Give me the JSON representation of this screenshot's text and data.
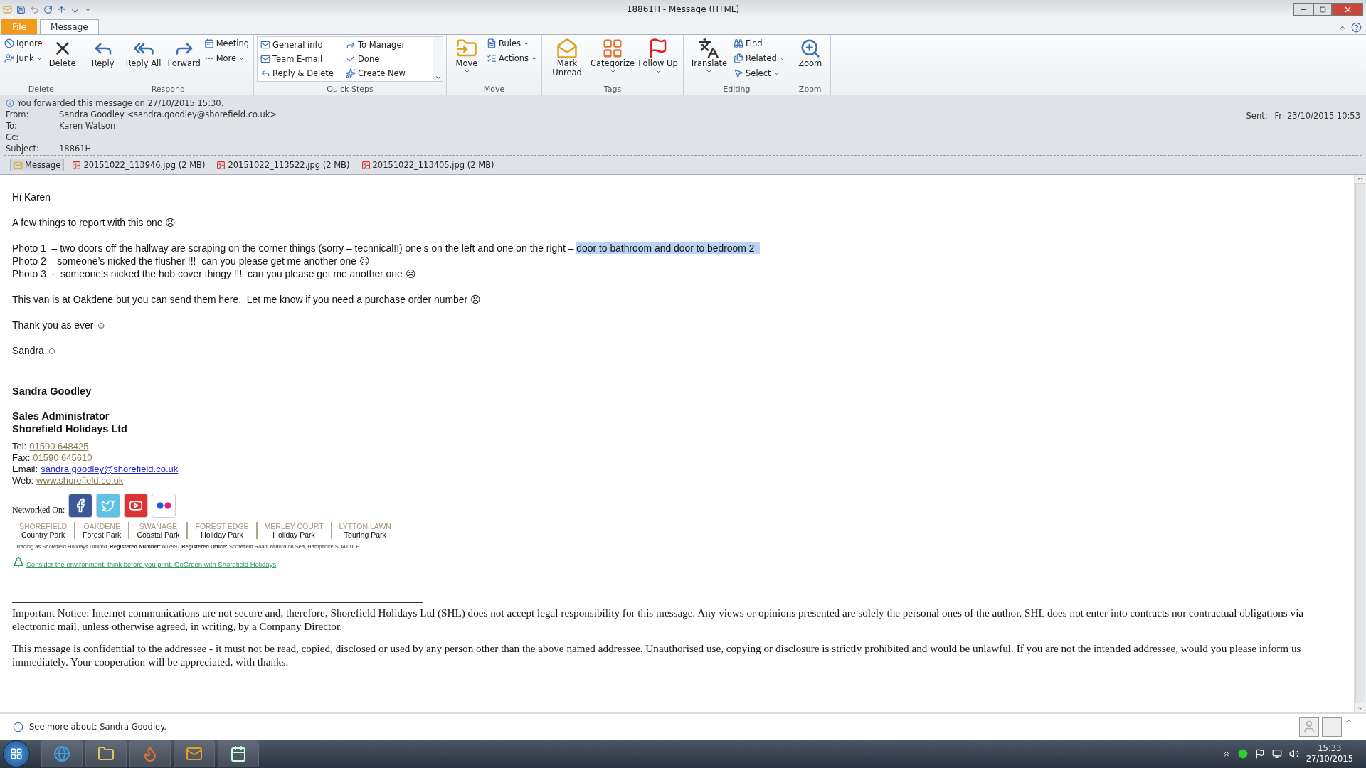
{
  "window": {
    "title": "18861H  -  Message (HTML)"
  },
  "tabs": [
    {
      "label": "File",
      "kind": "file",
      "selected": false
    },
    {
      "label": "Message",
      "kind": "tab",
      "selected": true
    }
  ],
  "ribbon": [
    {
      "label": "Delete",
      "items": [
        {
          "label": "Ignore",
          "kind": "small"
        },
        {
          "label": "Junk",
          "kind": "small",
          "dropdown": true
        },
        {
          "label": "Delete",
          "kind": "large"
        }
      ]
    },
    {
      "label": "Respond",
      "items": [
        {
          "label": "Reply",
          "kind": "large"
        },
        {
          "label": "Reply All",
          "kind": "large"
        },
        {
          "label": "Forward",
          "kind": "large"
        },
        {
          "label": "Meeting",
          "kind": "small"
        },
        {
          "label": "More",
          "kind": "small",
          "dropdown": true
        }
      ]
    },
    {
      "label": "Quick Steps",
      "items": [
        {
          "label": "General info",
          "kind": "quick"
        },
        {
          "label": "To Manager",
          "kind": "quick"
        },
        {
          "label": "Team E-mail",
          "kind": "quick"
        },
        {
          "label": "Done",
          "kind": "quick"
        },
        {
          "label": "Reply & Delete",
          "kind": "quick"
        },
        {
          "label": "Create New",
          "kind": "quick"
        }
      ]
    },
    {
      "label": "Move",
      "items": [
        {
          "label": "Move",
          "kind": "large",
          "dropdown": true
        },
        {
          "label": "Rules",
          "kind": "small",
          "dropdown": true
        },
        {
          "label": "Actions",
          "kind": "small",
          "dropdown": true
        }
      ]
    },
    {
      "label": "Tags",
      "items": [
        {
          "label": "Mark Unread",
          "kind": "large"
        },
        {
          "label": "Categorize",
          "kind": "large",
          "dropdown": true
        },
        {
          "label": "Follow Up",
          "kind": "large",
          "dropdown": true
        }
      ]
    },
    {
      "label": "Editing",
      "items": [
        {
          "label": "Translate",
          "kind": "large",
          "dropdown": true
        },
        {
          "label": "Find",
          "kind": "small"
        },
        {
          "label": "Related",
          "kind": "small",
          "dropdown": true
        },
        {
          "label": "Select",
          "kind": "small",
          "dropdown": true
        }
      ]
    },
    {
      "label": "Zoom",
      "items": [
        {
          "label": "Zoom",
          "kind": "large"
        }
      ]
    }
  ],
  "info_bar": "You forwarded this message on 27/10/2015 15:30.",
  "header": {
    "fields": [
      {
        "label": "From:",
        "value": "Sandra Goodley <sandra.goodley@shorefield.co.uk>"
      },
      {
        "label": "To:",
        "value": "Karen Watson"
      },
      {
        "label": "Cc:"
      },
      {
        "label": "Subject:",
        "value": "18861H"
      }
    ],
    "sent_label": "Sent:",
    "sent_value": "Fri 23/10/2015 10:53"
  },
  "attachments": [
    {
      "label": "Message",
      "kind": "message",
      "selected": true
    },
    {
      "label": "20151022_113946.jpg (2 MB)",
      "kind": "file",
      "selected": false
    },
    {
      "label": "20151022_113522.jpg (2 MB)",
      "kind": "file",
      "selected": false
    },
    {
      "label": "20151022_113405.jpg (2 MB)",
      "kind": "file",
      "selected": false
    }
  ],
  "body": [
    [
      {
        "text": "Hi Karen"
      }
    ],
    [
      {
        "text": "A few things to report with this one ☹"
      }
    ],
    [
      {
        "text": "Photo 1  – two doors off the hallway are scraping on the corner things (sorry – technical!!) one’s on the left and one on the right – "
      },
      {
        "text": "door to bathroom and door to bedroom 2  ",
        "highlighted": true
      }
    ],
    [
      {
        "text": "Photo 2 – someone’s nicked the flusher !!!  can you please get me another one ☹"
      }
    ],
    [
      {
        "text": "Photo 3  -  someone’s nicked the hob cover thingy !!!  can you please get me another one ☹"
      }
    ],
    [
      {
        "text": "This van is at Oakdene but you can send them here.  Let me know if you need a purchase order number ☹"
      }
    ],
    [
      {
        "text": "Thank you as ever ☺"
      }
    ],
    [
      {
        "text": "Sandra ☺"
      }
    ]
  ],
  "signature": {
    "name": "Sandra Goodley",
    "job_title": "Sales Administrator",
    "company": "Shorefield Holidays Ltd",
    "contacts": [
      {
        "label": "Tel:",
        "value": "01590 648425",
        "color": "#8a7a50"
      },
      {
        "label": "Fax:",
        "value": "01590 645610",
        "color": "#8a7a50"
      },
      {
        "label": "Email:",
        "value": "sandra.goodley@shorefield.co.uk",
        "color": "#1f1fcc"
      },
      {
        "label": "Web:",
        "value": "www.shorefield.co.uk",
        "color": "#8a7a50"
      }
    ],
    "networked_label": "Networked On:",
    "parks": [
      {
        "name": "SHOREFIELD",
        "type": "Country Park"
      },
      {
        "name": "OAKDENE",
        "type": "Forest Park"
      },
      {
        "name": "SWANAGE",
        "type": "Coastal Park"
      },
      {
        "name": "FOREST EDGE",
        "type": "Holiday Park"
      },
      {
        "name": "MERLEY COURT",
        "type": "Holiday Park"
      },
      {
        "name": "LYTTON LAWN",
        "type": "Touring Park"
      }
    ],
    "trading": "Trading as Shorefield Holidays Limited. **Registered Number:** 607997 **Registered Office:** Shorefield Road, Milford on Sea, Hampshire SO41 0LH",
    "green_link": "Consider the environment, think before you print. GoGreen with Shorefield Holidays"
  },
  "disclaimer": [
    "Important Notice: Internet communications are not secure and, therefore, Shorefield Holidays Ltd (SHL) does not accept legal responsibility for this message. Any views or opinions presented are solely the personal ones of the author. SHL does not enter into contracts nor contractual obligations via electronic mail, unless otherwise agreed, in writing, by a Company Director.",
    "This message is confidential to the addressee - it must not be read, copied, disclosed or used by any person other than the above named addressee. Unauthorised use, copying or disclosure is strictly prohibited and would be unlawful. If you are not the intended addressee, would you please inform us immediately. Your cooperation will be appreciated, with thanks."
  ],
  "people_pane": "See more about: Sandra Goodley.",
  "taskbar": {
    "time": "15:33",
    "date": "27/10/2015"
  }
}
